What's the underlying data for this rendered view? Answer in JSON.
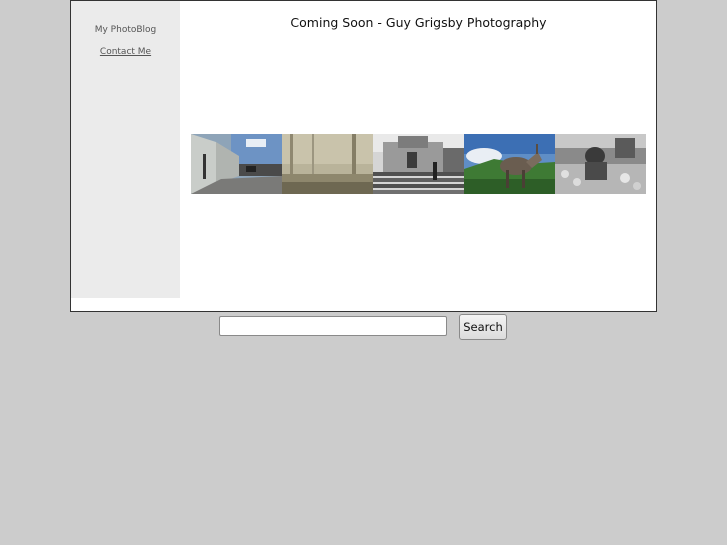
{
  "sidebar": {
    "items": [
      {
        "label": "My PhotoBlog"
      },
      {
        "label": "Contact Me"
      }
    ]
  },
  "main": {
    "title": "Coming Soon - Guy Grigsby Photography"
  },
  "photo_strip": {
    "photos": [
      {
        "icon": "street-wall-photo"
      },
      {
        "icon": "misty-landscape-photo"
      },
      {
        "icon": "church-steps-photo"
      },
      {
        "icon": "donkey-photo"
      },
      {
        "icon": "market-vendor-photo"
      }
    ]
  },
  "search": {
    "value": "",
    "placeholder": "",
    "button_label": "Search"
  },
  "colors": {
    "page_background": "#cccccc",
    "sidebar_background": "#ebebeb",
    "content_background": "#ffffff"
  }
}
